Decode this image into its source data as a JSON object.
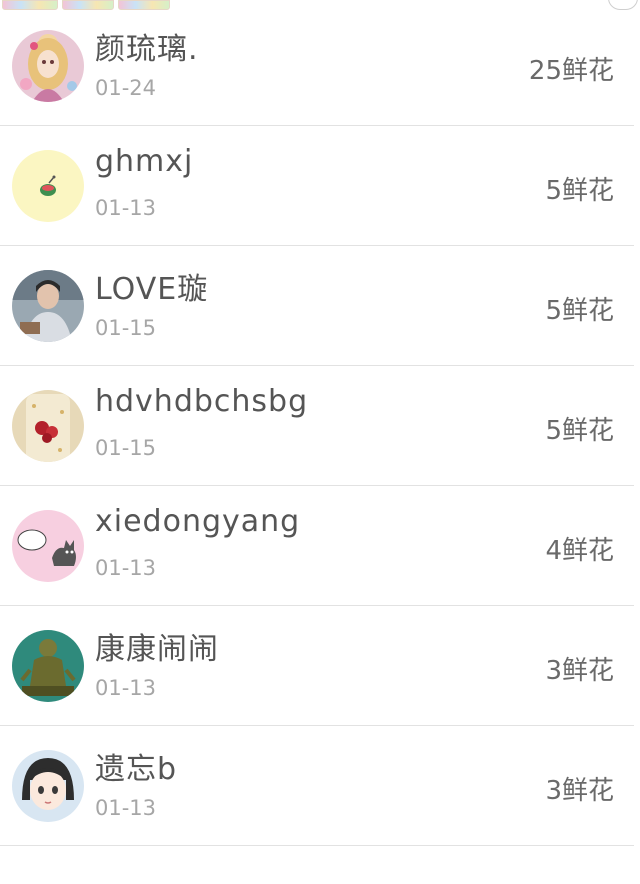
{
  "rows": [
    {
      "name": "颜琉璃.",
      "date": "01-24",
      "flowers": "25鲜花",
      "avatar_icon": "doll-avatar-icon"
    },
    {
      "name": "ghmxj",
      "date": "01-13",
      "flowers": "5鲜花",
      "avatar_icon": "watermelon-avatar-icon"
    },
    {
      "name": "LOVE璇",
      "date": "01-15",
      "flowers": "5鲜花",
      "avatar_icon": "boy-photo-avatar-icon"
    },
    {
      "name": "hdvhdbchsbg",
      "date": "01-15",
      "flowers": "5鲜花",
      "avatar_icon": "phone-case-avatar-icon"
    },
    {
      "name": "xiedongyang",
      "date": "01-13",
      "flowers": "4鲜花",
      "avatar_icon": "cat-cartoon-avatar-icon"
    },
    {
      "name": "康康闹闹",
      "date": "01-13",
      "flowers": "3鲜花",
      "avatar_icon": "statue-avatar-icon"
    },
    {
      "name": "遗忘b",
      "date": "01-13",
      "flowers": "3鲜花",
      "avatar_icon": "anime-girl-avatar-icon"
    }
  ]
}
